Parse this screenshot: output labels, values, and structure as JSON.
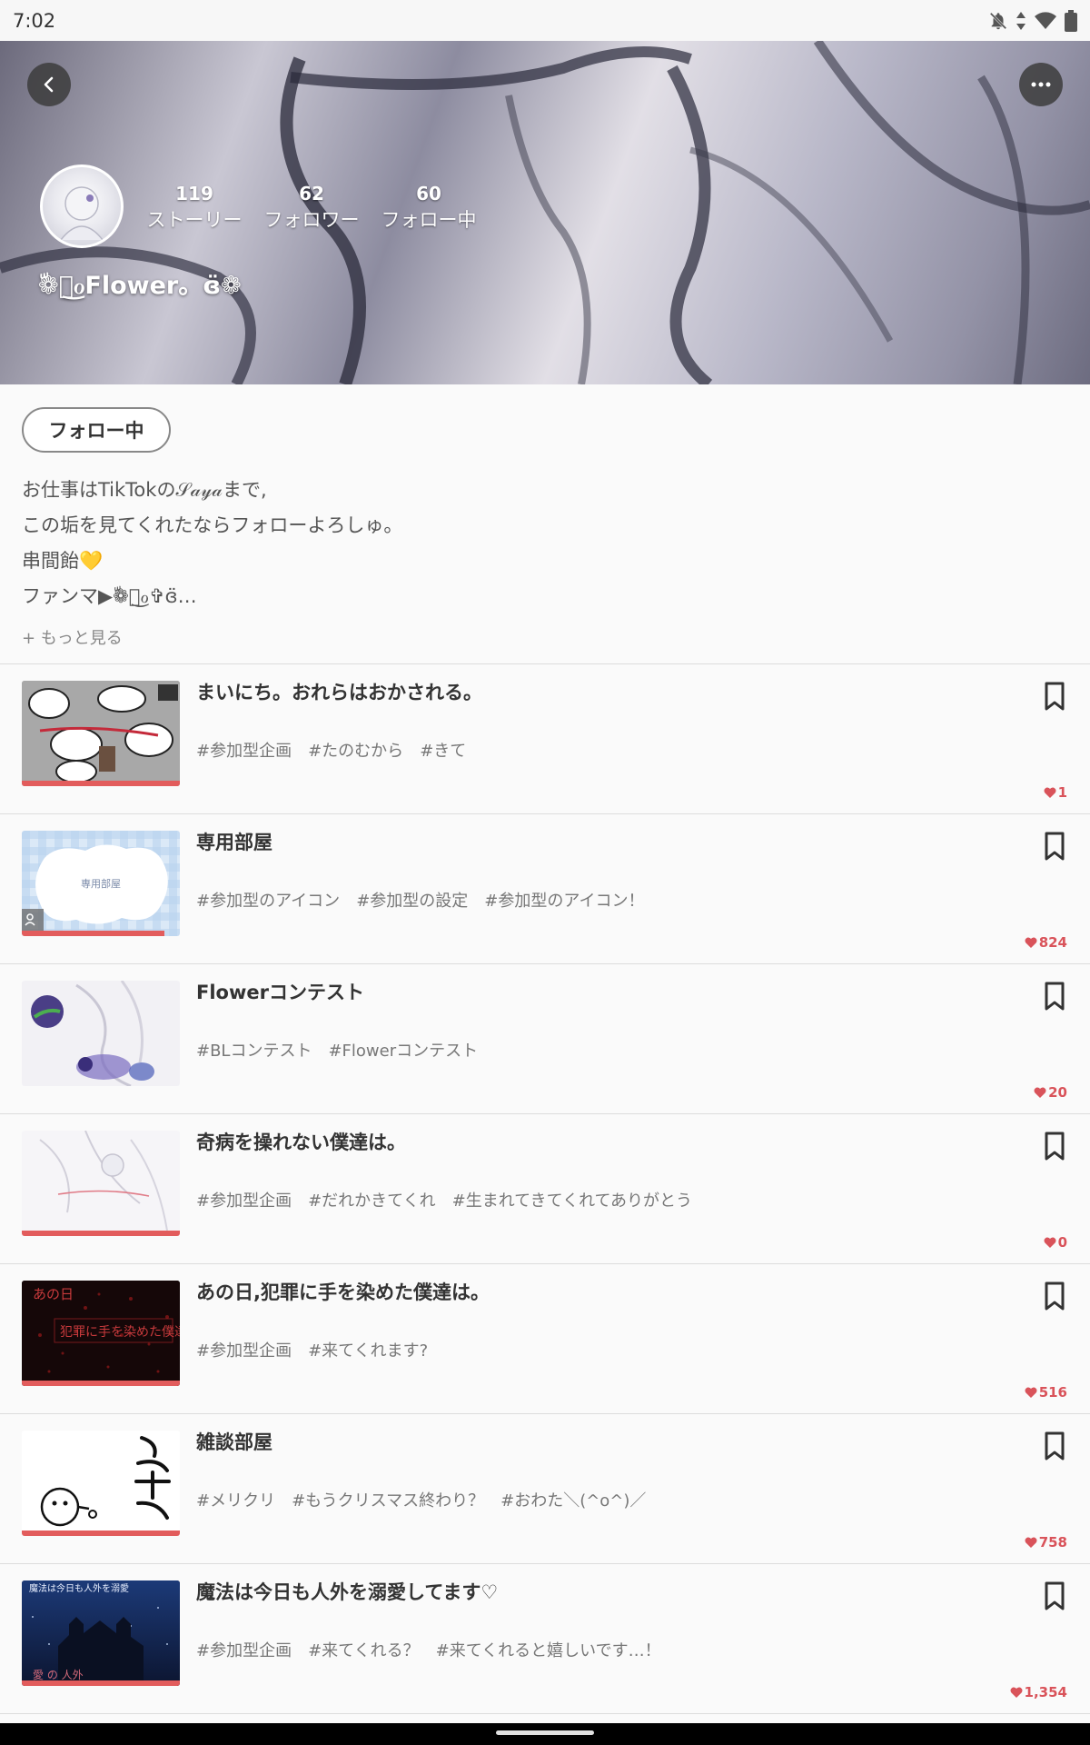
{
  "status_bar": {
    "time": "7:02",
    "icons": [
      "bell-off-icon",
      "data-arrows-icon",
      "wifi-icon",
      "battery-icon"
    ]
  },
  "profile": {
    "stats": [
      {
        "value": "119",
        "label": "ストーリー"
      },
      {
        "value": "62",
        "label": "フォロワー"
      },
      {
        "value": "60",
        "label": "フォロー中"
      }
    ],
    "display_name": "❁ّཻ͜ℴFlower。ɞ̈❁",
    "follow_button": "フォロー中",
    "bio": [
      "お仕事はTikTokの𝒮𝒶𝓎𝒶まで,",
      "この垢を見てくれたならフォローよろしゅ。",
      "串間飴💛",
      "ファンマ▶❁ّཻ͜ℴ✞ɞ̈…"
    ],
    "see_more": "+ もっと見る"
  },
  "stories": [
    {
      "title": "まいにち。おれらはおかされる。",
      "tags": [
        "#参加型企画",
        "#たのむから",
        "#きて"
      ],
      "likes": "1",
      "thumb_text": ""
    },
    {
      "title": "専用部屋",
      "tags": [
        "#参加型のアイコン",
        "#参加型の設定",
        "#参加型のアイコン！"
      ],
      "likes": "824",
      "thumb_text": "専用部屋"
    },
    {
      "title": "Flowerコンテスト",
      "tags": [
        "#BLコンテスト",
        "#Flowerコンテスト"
      ],
      "likes": "20",
      "thumb_text": ""
    },
    {
      "title": "奇病を操れない僕達は。",
      "tags": [
        "#参加型企画",
        "#だれかきてくれ",
        "#生まれてきてくれてありがとう"
      ],
      "likes": "0",
      "thumb_text": ""
    },
    {
      "title": "あの日,犯罪に手を染めた僕達は。",
      "tags": [
        "#参加型企画",
        "#来てくれます?"
      ],
      "likes": "516",
      "thumb_text": "あの日"
    },
    {
      "title": "雑談部屋",
      "tags": [
        "#メリクリ",
        "#もうクリスマス終わり？",
        "#おわた＼(^o^)／"
      ],
      "likes": "758",
      "thumb_text": ""
    },
    {
      "title": "魔法は今日も人外を溺愛してます♡",
      "tags": [
        "#参加型企画",
        "#来てくれる？",
        "#来てくれると嬉しいです…！"
      ],
      "likes": "1,354",
      "thumb_text": ""
    }
  ],
  "colors": {
    "accent": "#e25c5c",
    "likes": "#d9535a"
  }
}
